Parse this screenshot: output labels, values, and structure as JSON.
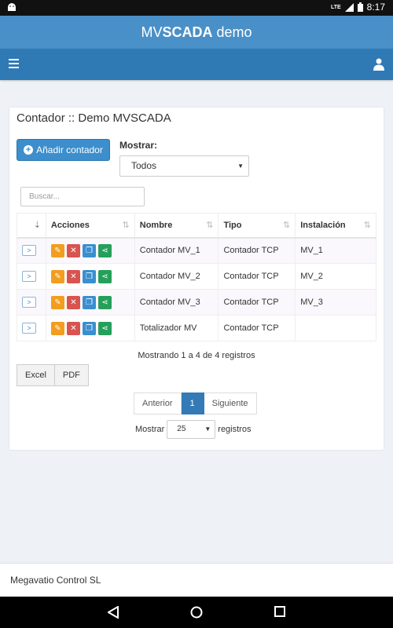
{
  "status": {
    "time": "8:17",
    "network": "LTE"
  },
  "app": {
    "title_pre": "MV",
    "title_bold": "SCADA",
    "title_post": " demo"
  },
  "panel": {
    "title": "Contador :: Demo MVSCADA",
    "add_button": "Añadir contador",
    "show_label": "Mostrar:",
    "show_value": "Todos",
    "search_placeholder": "Buscar..."
  },
  "table": {
    "headers": [
      "",
      "Acciones",
      "Nombre",
      "Tipo",
      "Instalación"
    ],
    "rows": [
      {
        "expand": ">",
        "nombre": "Contador MV_1",
        "tipo": "Contador TCP",
        "instalacion": "MV_1"
      },
      {
        "expand": ">",
        "nombre": "Contador MV_2",
        "tipo": "Contador TCP",
        "instalacion": "MV_2"
      },
      {
        "expand": ">",
        "nombre": "Contador MV_3",
        "tipo": "Contador TCP",
        "instalacion": "MV_3"
      },
      {
        "expand": ">",
        "nombre": "Totalizador MV",
        "tipo": "Contador TCP",
        "instalacion": ""
      }
    ]
  },
  "info": "Mostrando 1 a 4 de 4 registros",
  "export": {
    "excel": "Excel",
    "pdf": "PDF"
  },
  "pager": {
    "prev": "Anterior",
    "page": "1",
    "next": "Siguiente"
  },
  "length": {
    "pre": "Mostrar",
    "value": "25",
    "post": "registros"
  },
  "footer": "Megavatio Control SL",
  "colors": {
    "appbar": "#4a90c8",
    "navbar": "#2f79b4",
    "primary": "#337ab7",
    "edit": "#f29d1f",
    "delete": "#d9534f",
    "copy": "#3a8fd0",
    "share": "#25a05a"
  }
}
